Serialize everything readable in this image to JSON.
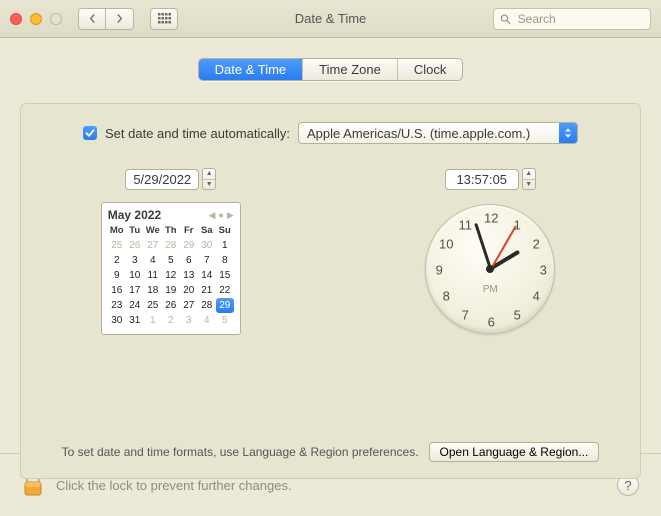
{
  "window": {
    "title": "Date & Time"
  },
  "search": {
    "placeholder": "Search"
  },
  "tabs": [
    "Date & Time",
    "Time Zone",
    "Clock"
  ],
  "active_tab": 0,
  "auto": {
    "checked": true,
    "label": "Set date and time automatically:",
    "server": "Apple Americas/U.S. (time.apple.com.)"
  },
  "date": {
    "value": "5/29/2022"
  },
  "time": {
    "value": "13:57:05"
  },
  "calendar": {
    "month_year": "May 2022",
    "dow": [
      "Mo",
      "Tu",
      "We",
      "Th",
      "Fr",
      "Sa",
      "Su"
    ],
    "prev_trail": [
      25,
      26,
      27,
      28,
      29,
      30
    ],
    "days": [
      1,
      2,
      3,
      4,
      5,
      6,
      7,
      8,
      9,
      10,
      11,
      12,
      13,
      14,
      15,
      16,
      17,
      18,
      19,
      20,
      21,
      22,
      23,
      24,
      25,
      26,
      27,
      28,
      29,
      30,
      31
    ],
    "next_trail": [
      1,
      2,
      3,
      4,
      5
    ],
    "selected": 29
  },
  "clock": {
    "numbers": [
      12,
      1,
      2,
      3,
      4,
      5,
      6,
      7,
      8,
      9,
      10,
      11
    ],
    "ampm": "PM",
    "hour_angle": 59,
    "minute_angle": 342,
    "second_angle": 30
  },
  "hint": {
    "text": "To set date and time formats, use Language & Region preferences.",
    "button": "Open Language & Region..."
  },
  "footer": {
    "lock_text": "Click the lock to prevent further changes.",
    "help": "?"
  }
}
